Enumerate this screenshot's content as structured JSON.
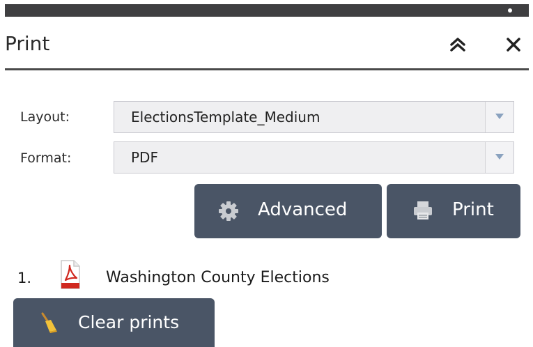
{
  "panel": {
    "title": "Print",
    "collapse_icon": "double-chevron-up-icon",
    "close_icon": "close-icon"
  },
  "form": {
    "layout_label": "Layout:",
    "layout_value": "ElectionsTemplate_Medium",
    "format_label": "Format:",
    "format_value": "PDF"
  },
  "buttons": {
    "advanced_label": "Advanced",
    "advanced_icon": "gear-icon",
    "print_label": "Print",
    "print_icon": "printer-icon",
    "clear_label": "Clear prints",
    "clear_icon": "broom-icon"
  },
  "results": [
    {
      "number": "1.",
      "icon": "pdf-file-icon",
      "title": "Washington County Elections"
    }
  ],
  "colors": {
    "button_bg": "#4a5566",
    "topbar_bg": "#3f3f41",
    "select_bg": "#efeff1"
  }
}
